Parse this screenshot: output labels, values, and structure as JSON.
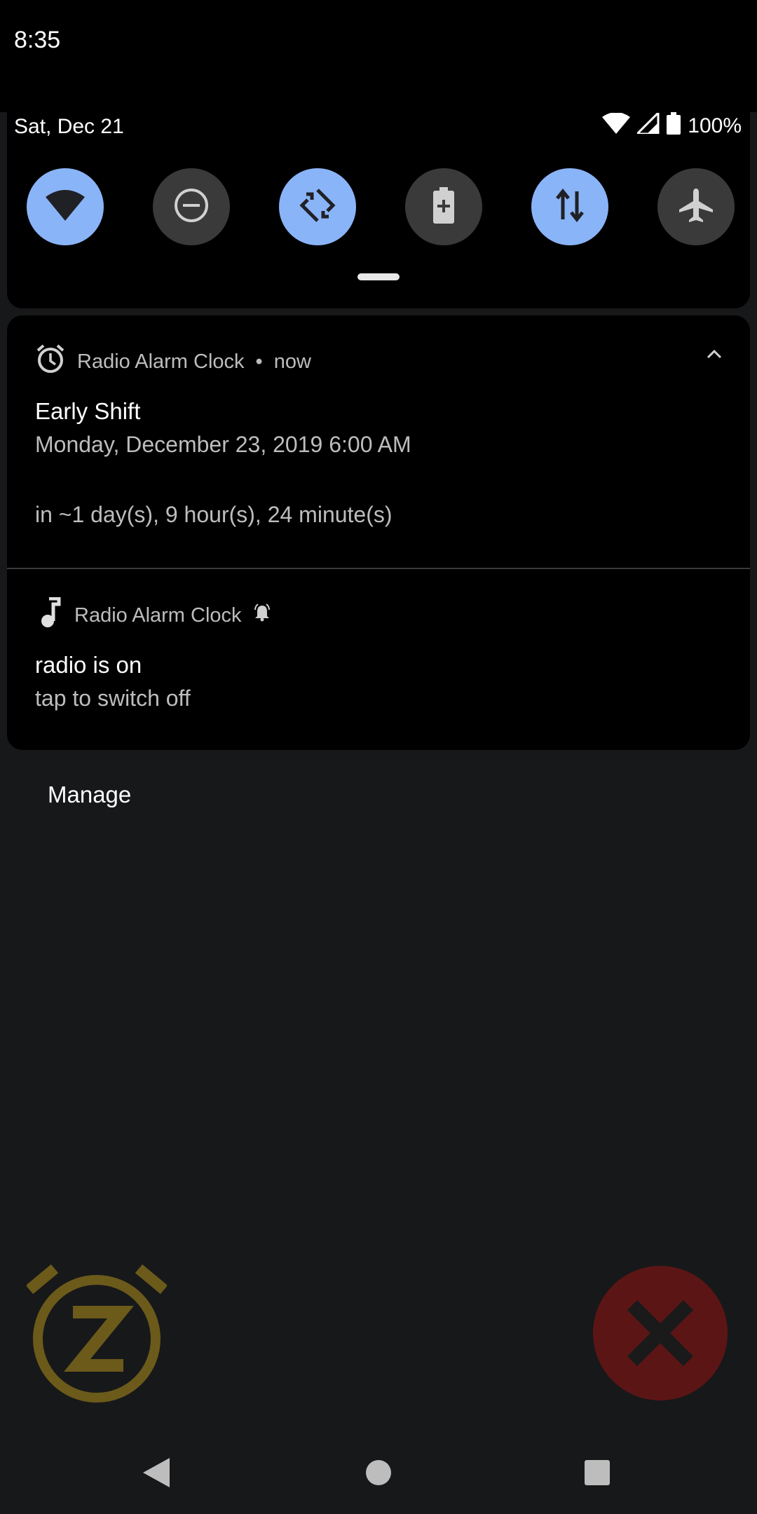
{
  "status_bar": {
    "time": "8:35"
  },
  "quick_settings": {
    "date": "Sat, Dec 21",
    "battery": "100%",
    "tiles": [
      {
        "icon": "wifi-icon",
        "active": true
      },
      {
        "icon": "do-not-disturb-icon",
        "active": false
      },
      {
        "icon": "auto-rotate-icon",
        "active": true
      },
      {
        "icon": "battery-saver-icon",
        "active": false
      },
      {
        "icon": "mobile-data-icon",
        "active": true
      },
      {
        "icon": "airplane-mode-icon",
        "active": false
      }
    ]
  },
  "notifications": [
    {
      "app": "Radio Alarm Clock",
      "time": "now",
      "title": "Early Shift",
      "line1": "Monday, December 23, 2019 6:00 AM",
      "line2": "in ~1 day(s), 9 hour(s), 24 minute(s)"
    },
    {
      "app": "Radio Alarm Clock",
      "title": "radio is on",
      "line1": "tap to switch off"
    }
  ],
  "manage_label": "Manage",
  "colors": {
    "accent": "#8ab4f8",
    "snooze": "#6b5a1a",
    "dismiss": "#5c1515"
  }
}
